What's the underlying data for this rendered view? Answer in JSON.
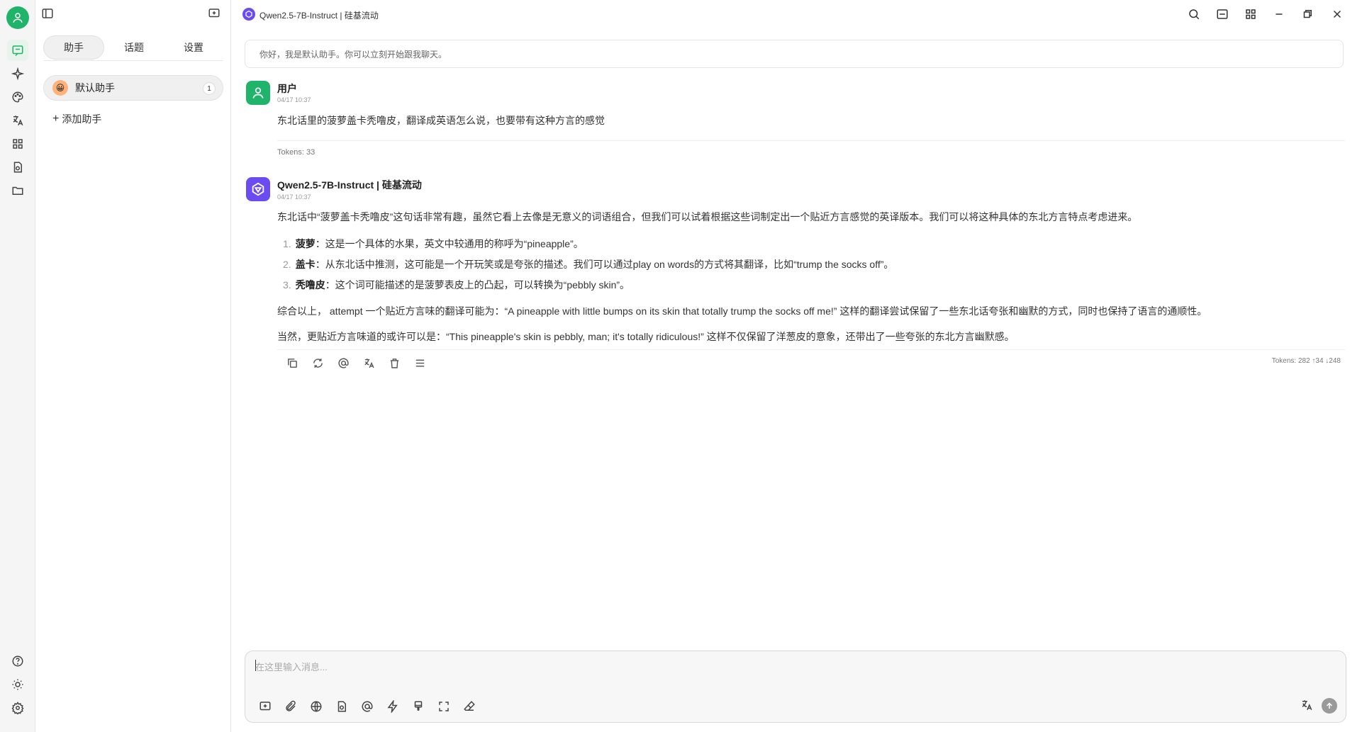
{
  "window": {
    "title": "Qwen2.5-7B-Instruct | 硅基流动"
  },
  "sidebar": {
    "tabs": [
      {
        "label": "助手"
      },
      {
        "label": "话题"
      },
      {
        "label": "设置"
      }
    ],
    "assistant": {
      "name": "默认助手",
      "count": "1",
      "emoji": "😀"
    },
    "add_label": "添加助手"
  },
  "prompt": {
    "text": "你好，我是默认助手。你可以立刻开始跟我聊天。"
  },
  "messages": {
    "user": {
      "name": "用户",
      "time": "04/17 10:37",
      "text": "东北话里的菠萝盖卡秃噜皮，翻译成英语怎么说，也要带有这种方言的感觉",
      "tokens": "Tokens: 33"
    },
    "assistant": {
      "name": "Qwen2.5-7B-Instruct | 硅基流动",
      "time": "04/17 10:37",
      "intro": "东北话中“菠萝盖卡秃噜皮”这句话非常有趣，虽然它看上去像是无意义的词语组合，但我们可以试着根据这些词制定出一个贴近方言感觉的英译版本。我们可以将这种具体的东北方言特点考虑进来。",
      "list": [
        {
          "num": "1.",
          "term": "菠萝",
          "text": "：这是一个具体的水果，英文中较通用的称呼为“pineapple”。"
        },
        {
          "num": "2.",
          "term": "盖卡",
          "text": "：从东北话中推测，这可能是一个开玩笑或是夸张的描述。我们可以通过play on words的方式将其翻译，比如“trump the socks off”。"
        },
        {
          "num": "3.",
          "term": "秃噜皮",
          "text": "：这个词可能描述的是菠萝表皮上的凸起，可以转换为“pebbly skin”。"
        }
      ],
      "para1": "综合以上， attempt 一个贴近方言味的翻译可能为：“A pineapple with little bumps on its skin that totally trump the socks off me!” 这样的翻译尝试保留了一些东北话夸张和幽默的方式，同时也保持了语言的通顺性。",
      "para2": "当然，更贴近方言味道的或许可以是：“This pineapple's skin is pebbly, man; it's totally ridiculous!” 这样不仅保留了洋葱皮的意象，还带出了一些夸张的东北方言幽默感。",
      "tokens": "Tokens: 282 ↑34 ↓248"
    }
  },
  "input": {
    "placeholder": "在这里输入消息..."
  },
  "colors": {
    "brand_green": "#1fb46a",
    "model_purple": "#6a4cf0"
  }
}
